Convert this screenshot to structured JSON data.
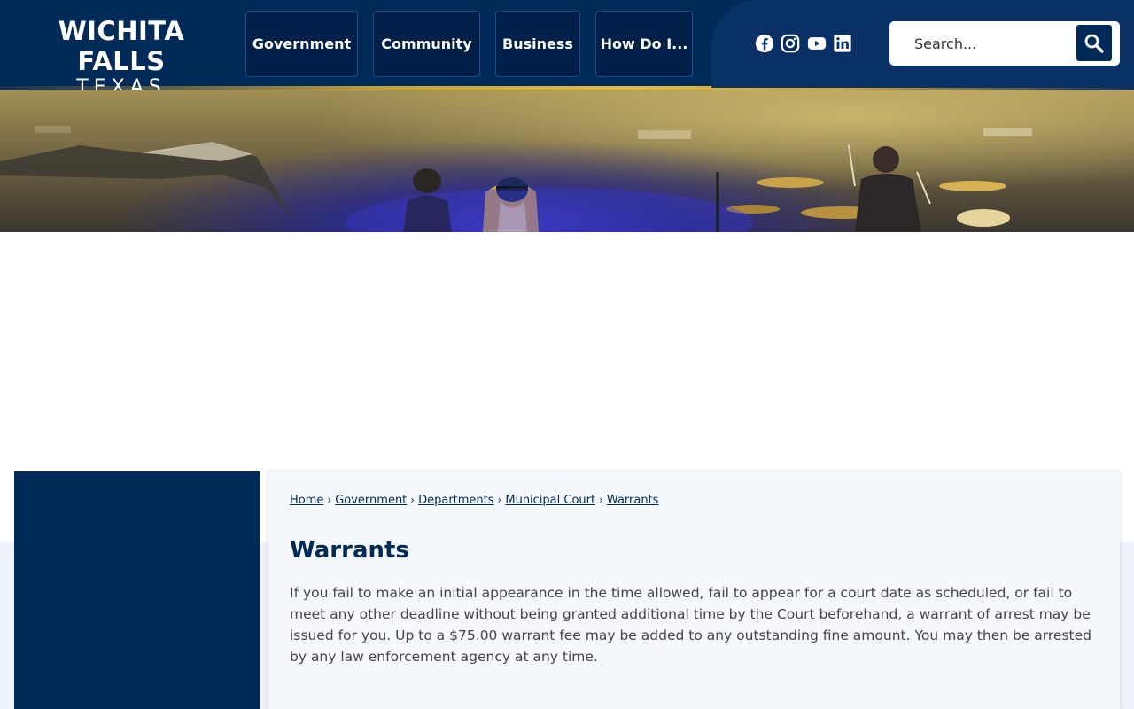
{
  "logo": {
    "line1": "WICHITA FALLS",
    "line2": "TEXAS"
  },
  "nav": {
    "government": "Government",
    "community": "Community",
    "business": "Business",
    "how_do_i": "How Do I..."
  },
  "social": {
    "icons": [
      "facebook-icon",
      "instagram-icon",
      "youtube-icon",
      "linkedin-icon"
    ]
  },
  "search": {
    "placeholder": "Search..."
  },
  "breadcrumb": {
    "items": [
      "Home",
      "Government",
      "Departments",
      "Municipal Court",
      "Warrants"
    ],
    "separator": "›"
  },
  "page": {
    "title": "Warrants",
    "body": "If you fail to make an initial appearance in the time allowed, fail to appear for a court date as scheduled, or fail to meet any other deadline without being granted additional time by the Court beforehand, a warrant of arrest may be issued for you. Up to a $75.00 warrant fee may be added to any outstanding fine amount. You may then be arrested by any law enforcement agency at any time."
  },
  "colors": {
    "navy": "#002a58",
    "gold": "#e0bb4a",
    "content_bg": "#f5f8fc",
    "text": "#444444"
  }
}
